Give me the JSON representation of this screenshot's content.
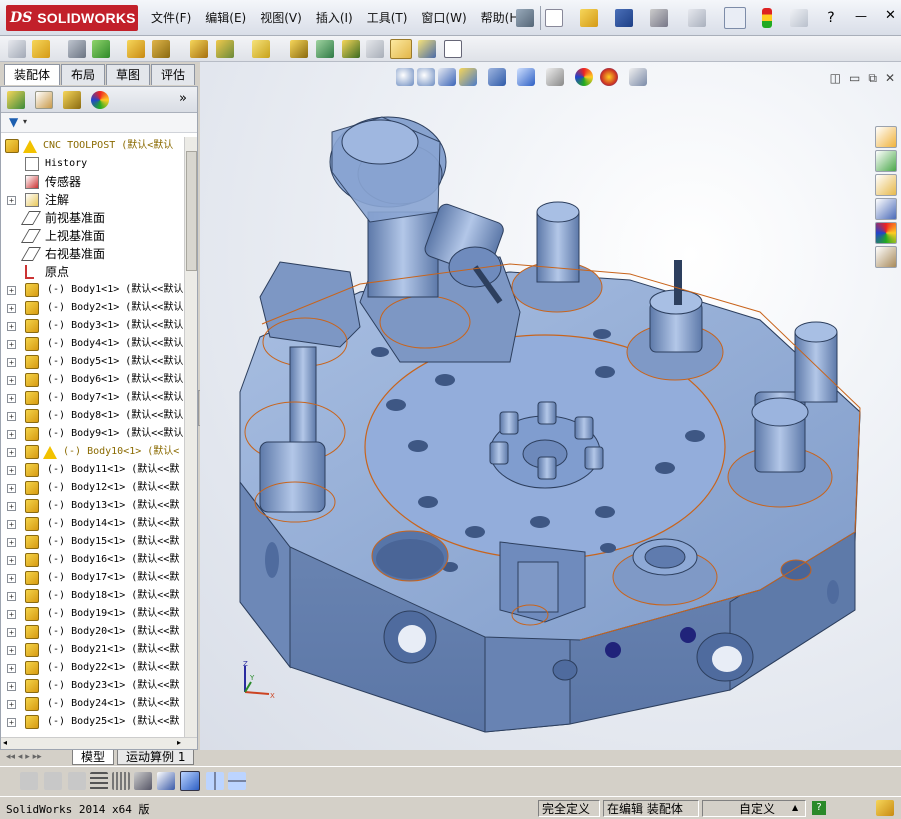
{
  "app": {
    "logo_ds": "DS",
    "logo_name": "SOLIDWORKS"
  },
  "menu": [
    "文件(F)",
    "编辑(E)",
    "视图(V)",
    "插入(I)",
    "工具(T)",
    "窗口(W)",
    "帮助(H)"
  ],
  "command_tabs": [
    "装配体",
    "布局",
    "草图",
    "评估"
  ],
  "tree": {
    "root": "CNC TOOLPOST  (默认<默认",
    "nodes": [
      "History",
      "传感器",
      "注解",
      "前视基准面",
      "上视基准面",
      "右视基准面",
      "原点"
    ],
    "bodies": [
      {
        "label": "(-) Body1<1> (默认<<默认",
        "warn": false
      },
      {
        "label": "(-) Body2<1> (默认<<默认",
        "warn": false
      },
      {
        "label": "(-) Body3<1> (默认<<默认",
        "warn": false
      },
      {
        "label": "(-) Body4<1> (默认<<默认",
        "warn": false
      },
      {
        "label": "(-) Body5<1> (默认<<默认",
        "warn": false
      },
      {
        "label": "(-) Body6<1> (默认<<默认",
        "warn": false
      },
      {
        "label": "(-) Body7<1> (默认<<默认",
        "warn": false
      },
      {
        "label": "(-) Body8<1> (默认<<默认",
        "warn": false
      },
      {
        "label": "(-) Body9<1> (默认<<默认",
        "warn": false
      },
      {
        "label": "(-) Body10<1> (默认<",
        "warn": true
      },
      {
        "label": "(-) Body11<1> (默认<<默",
        "warn": false
      },
      {
        "label": "(-) Body12<1> (默认<<默",
        "warn": false
      },
      {
        "label": "(-) Body13<1> (默认<<默",
        "warn": false
      },
      {
        "label": "(-) Body14<1> (默认<<默",
        "warn": false
      },
      {
        "label": "(-) Body15<1> (默认<<默",
        "warn": false
      },
      {
        "label": "(-) Body16<1> (默认<<默",
        "warn": false
      },
      {
        "label": "(-) Body17<1> (默认<<默",
        "warn": false
      },
      {
        "label": "(-) Body18<1> (默认<<默",
        "warn": false
      },
      {
        "label": "(-) Body19<1> (默认<<默",
        "warn": false
      },
      {
        "label": "(-) Body20<1> (默认<<默",
        "warn": false
      },
      {
        "label": "(-) Body21<1> (默认<<默",
        "warn": false
      },
      {
        "label": "(-) Body22<1> (默认<<默",
        "warn": false
      },
      {
        "label": "(-) Body23<1> (默认<<默",
        "warn": false
      },
      {
        "label": "(-) Body24<1> (默认<<默",
        "warn": false
      },
      {
        "label": "(-) Body25<1> (默认<<默",
        "warn": false
      }
    ]
  },
  "bottom_tabs": [
    "模型",
    "运动算例 1"
  ],
  "status": {
    "version": "SolidWorks 2014 x64 版",
    "definition": "完全定义",
    "mode": "在编辑 装配体",
    "units": "自定义",
    "help": "?"
  },
  "triad": {
    "x": "X",
    "y": "Y",
    "z": "Z"
  },
  "colors": {
    "model_blue": "#7a98c8",
    "sketch_orange": "#c8641c",
    "logo_red": "#c2202a"
  }
}
